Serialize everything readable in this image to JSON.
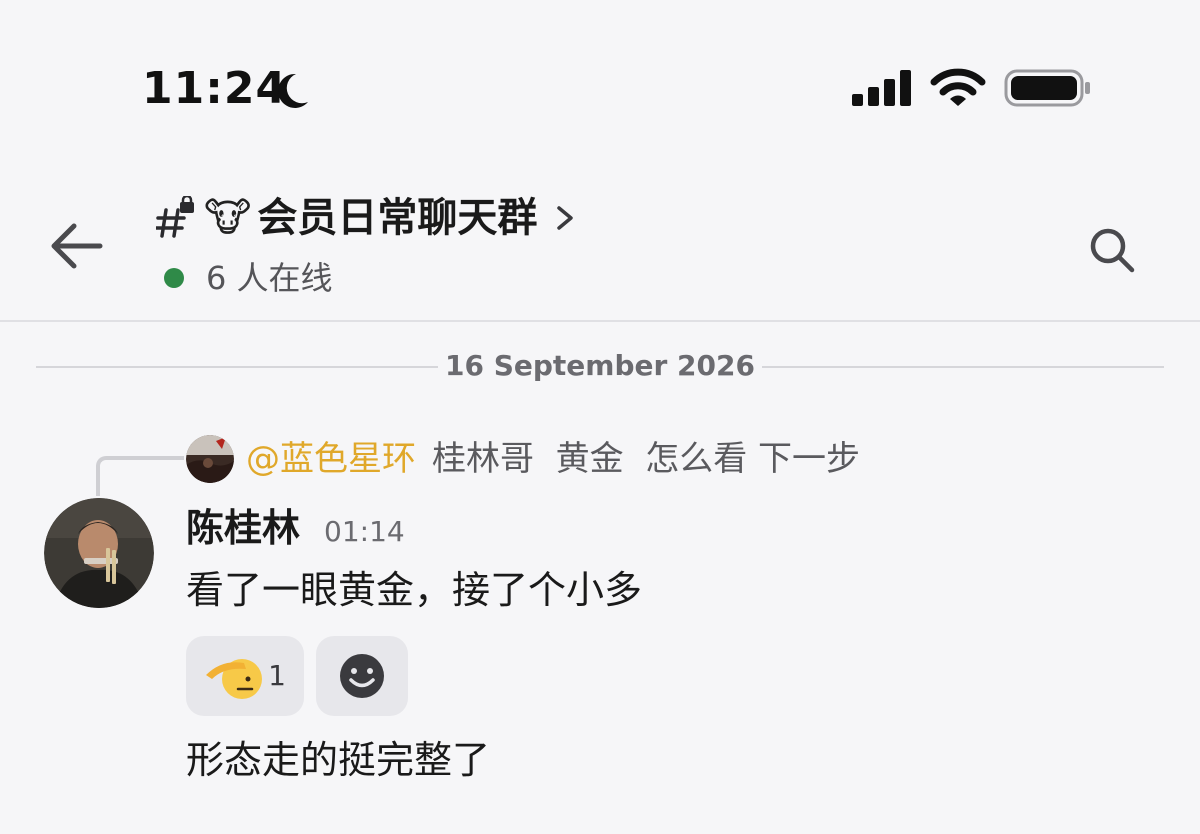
{
  "status_bar": {
    "time": "11:24",
    "icons": [
      "moon-icon",
      "signal-icon",
      "wifi-icon",
      "battery-icon"
    ]
  },
  "header": {
    "back_icon": "back-arrow-icon",
    "channel_icon": "hash-lock-icon",
    "channel_emoji": "🐮",
    "channel_name": "会员日常聊天群",
    "online_count_text": "6 人在线",
    "search_icon": "search-icon"
  },
  "date_divider": {
    "label": "16 September 2026"
  },
  "message": {
    "reply": {
      "mention": "@蓝色星环",
      "text": "桂林哥  黄金  怎么看 下一步"
    },
    "author": "陈桂林",
    "time": "01:14",
    "lines": [
      "看了一眼黄金，接了个小多",
      "形态走的挺完整了"
    ],
    "reactions": [
      {
        "emoji": "saluting-face-emoji",
        "count": "1"
      }
    ],
    "add_reaction_icon": "add-reaction-smiley-icon"
  },
  "colors": {
    "background": "#f6f6f8",
    "online_dot": "#2f8a48",
    "mention": "#e0a82a",
    "reaction_bg": "#e7e7eb"
  }
}
